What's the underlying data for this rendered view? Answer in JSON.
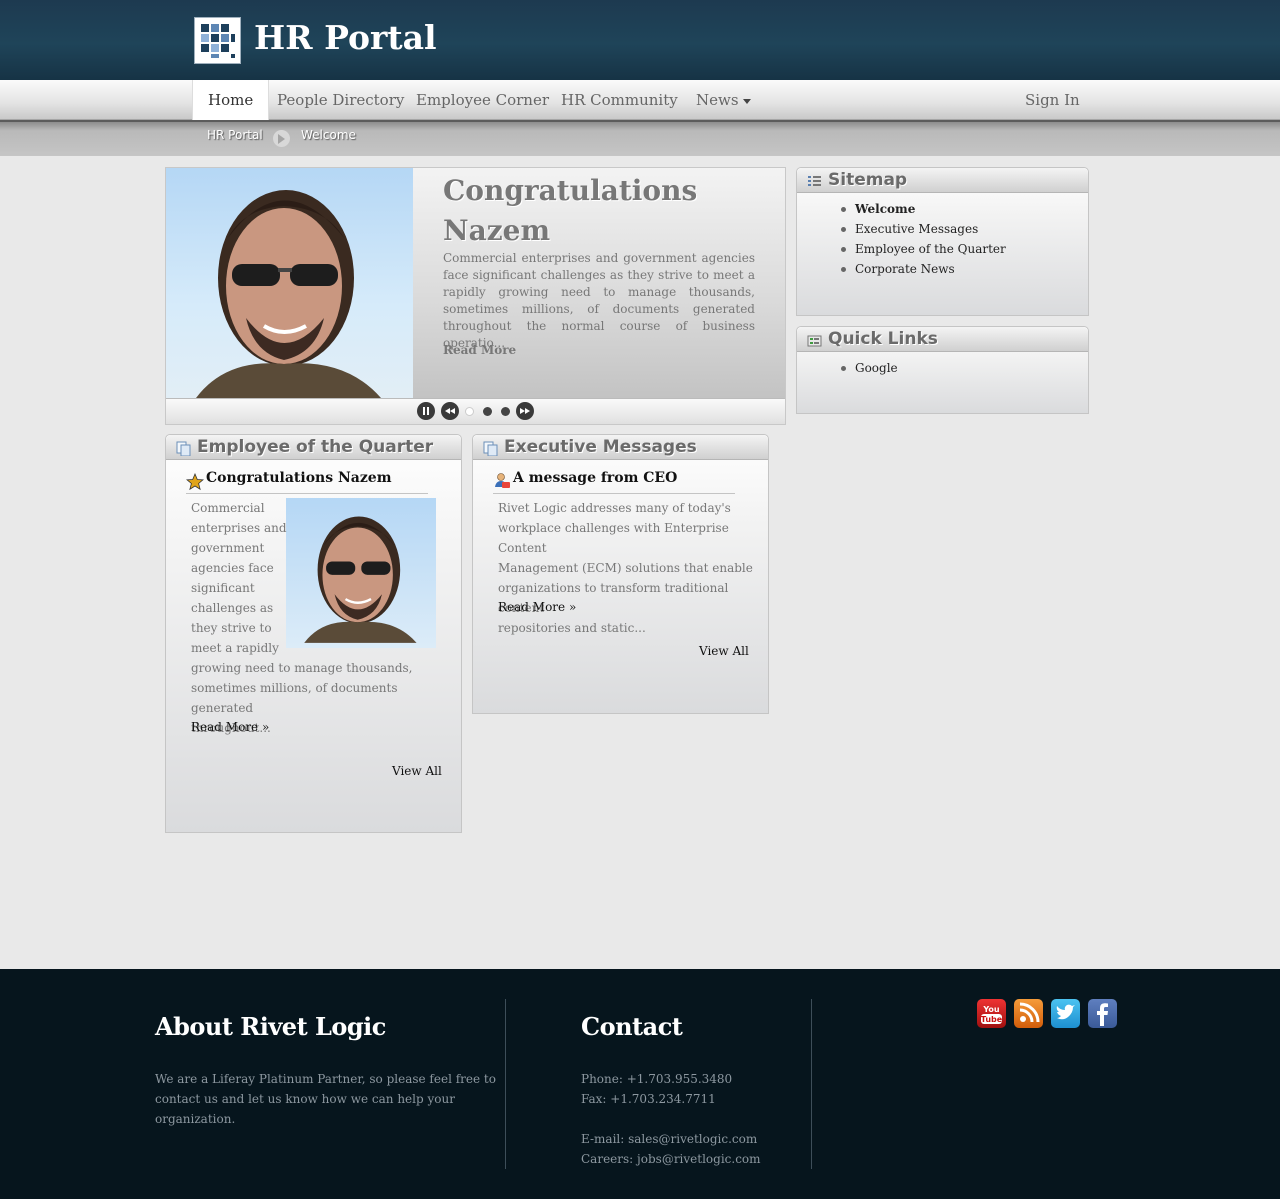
{
  "header": {
    "title": "HR Portal"
  },
  "nav": {
    "items": [
      {
        "label": "Home"
      },
      {
        "label": "People Directory"
      },
      {
        "label": "Employee Corner"
      },
      {
        "label": "HR Community"
      },
      {
        "label": "News"
      }
    ],
    "sign_in": "Sign In"
  },
  "breadcrumb": [
    "HR Portal",
    "Welcome"
  ],
  "slider": {
    "title": "Congratulations Nazem",
    "body": "Commercial enterprises and government agencies face significant challenges as they strive to meet a rapidly growing need to manage thousands, sometimes millions, of documents generated throughout the normal course of business operatio...",
    "read_more": "Read More"
  },
  "sitemap": {
    "title": "Sitemap",
    "items": [
      "Welcome",
      "Executive Messages",
      "Employee of the Quarter",
      "Corporate News"
    ]
  },
  "quick_links": {
    "title": "Quick Links",
    "items": [
      "Google"
    ]
  },
  "employee_quarter": {
    "title": "Employee of the Quarter",
    "entry_title": "Congratulations Nazem",
    "lines": [
      "Commercial",
      "enterprises and",
      "government",
      "agencies face",
      "significant",
      "challenges as",
      "they strive to",
      "meet a rapidly",
      "growing need to manage thousands,",
      "sometimes millions, of documents generated",
      "throughout..."
    ],
    "read_more": "Read More »",
    "view_all": "View All"
  },
  "executive_messages": {
    "title": "Executive Messages",
    "entry_title": "A message from CEO",
    "lines": [
      "Rivet Logic addresses many of today's",
      "workplace challenges with Enterprise Content",
      "Management (ECM) solutions that enable",
      "organizations to transform traditional content",
      "repositories and static..."
    ],
    "read_more": "Read More »",
    "view_all": "View All"
  },
  "footer": {
    "about_title": "About Rivet Logic",
    "about_lines": [
      "We are a Liferay Platinum Partner, so please feel free to",
      "contact us and let us know how we can help your",
      "organization."
    ],
    "contact_title": "Contact",
    "phone": "Phone: +1.703.955.3480",
    "fax": "Fax: +1.703.234.7711",
    "email": "E-mail: sales@rivetlogic.com",
    "careers": "Careers: jobs@rivetlogic.com"
  },
  "social": [
    "youtube-icon",
    "blog-rss-icon",
    "twitter-icon",
    "facebook-icon"
  ],
  "colors": {
    "header_bg": "#1f4459",
    "footer_bg": "#06151d",
    "page_bg": "#e9e9e9"
  }
}
